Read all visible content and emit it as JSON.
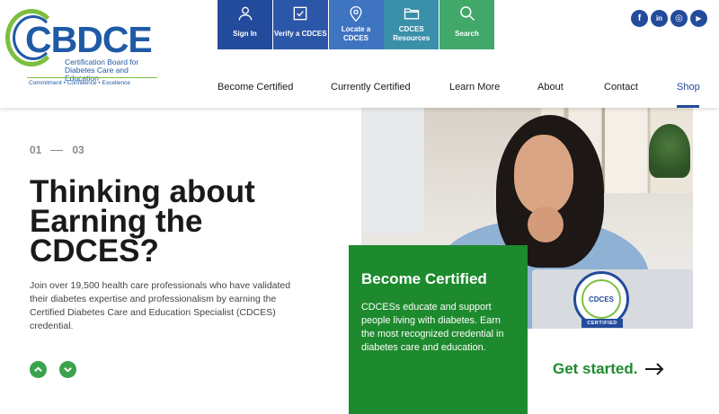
{
  "logo": {
    "wordmark": "CBDCE",
    "subtitle": "Certification Board for Diabetes Care and Education",
    "tagline": "Commitment • Confidence • Excellence"
  },
  "quick_links": [
    {
      "label": "Sign In",
      "icon": "user-icon"
    },
    {
      "label": "Verify a CDCES",
      "icon": "checkbox-icon"
    },
    {
      "label": "Locate a CDCES",
      "icon": "map-pin-icon"
    },
    {
      "label": "CDCES Resources",
      "icon": "folder-icon"
    },
    {
      "label": "Search",
      "icon": "search-icon"
    }
  ],
  "social": [
    {
      "name": "facebook-icon",
      "glyph": "f"
    },
    {
      "name": "linkedin-icon",
      "glyph": "in"
    },
    {
      "name": "instagram-icon",
      "glyph": "◎"
    },
    {
      "name": "youtube-icon",
      "glyph": "▶"
    }
  ],
  "nav": [
    "Become Certified",
    "Currently Certified",
    "Learn More",
    "About",
    "Contact",
    "Shop"
  ],
  "nav_active": "Shop",
  "hero": {
    "counter_current": "01",
    "counter_total": "03",
    "headline": "Thinking about Earning the CDCES?",
    "lede": "Join over 19,500 health care professionals who have validated their diabetes expertise and professionalism by earning the Certified Diabetes Care and Education Specialist (CDCES) credential."
  },
  "badge": {
    "text": "CDCES",
    "ribbon": "CERTIFIED"
  },
  "card": {
    "title": "Become Certified",
    "body": "CDCESs educate and support people living with diabetes. Earn the most recognized credential in diabetes care and education."
  },
  "cta": {
    "label": "Get started."
  },
  "colors": {
    "brand_blue": "#234b9c",
    "brand_green": "#1e8a2e",
    "accent_green": "#7bbf3f"
  }
}
